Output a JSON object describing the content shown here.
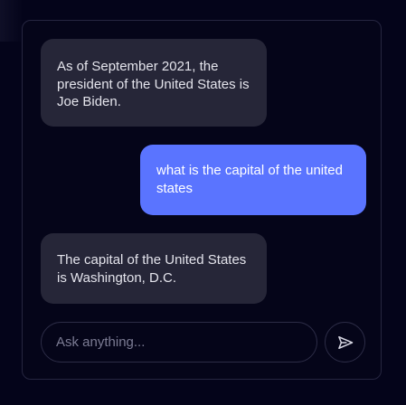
{
  "messages": [
    {
      "role": "assistant",
      "text": "As of September 2021, the president of the United States is Joe Biden."
    },
    {
      "role": "user",
      "text": "what is the capital of the united states"
    },
    {
      "role": "assistant",
      "text": "The capital of the United States is Washington, D.C."
    }
  ],
  "composer": {
    "placeholder": "Ask anything...",
    "value": "",
    "send_icon": "send-icon"
  },
  "colors": {
    "background": "#04041a",
    "panel_border": "#262640",
    "assistant_bubble": "#262638",
    "user_bubble": "#5a74ff"
  }
}
